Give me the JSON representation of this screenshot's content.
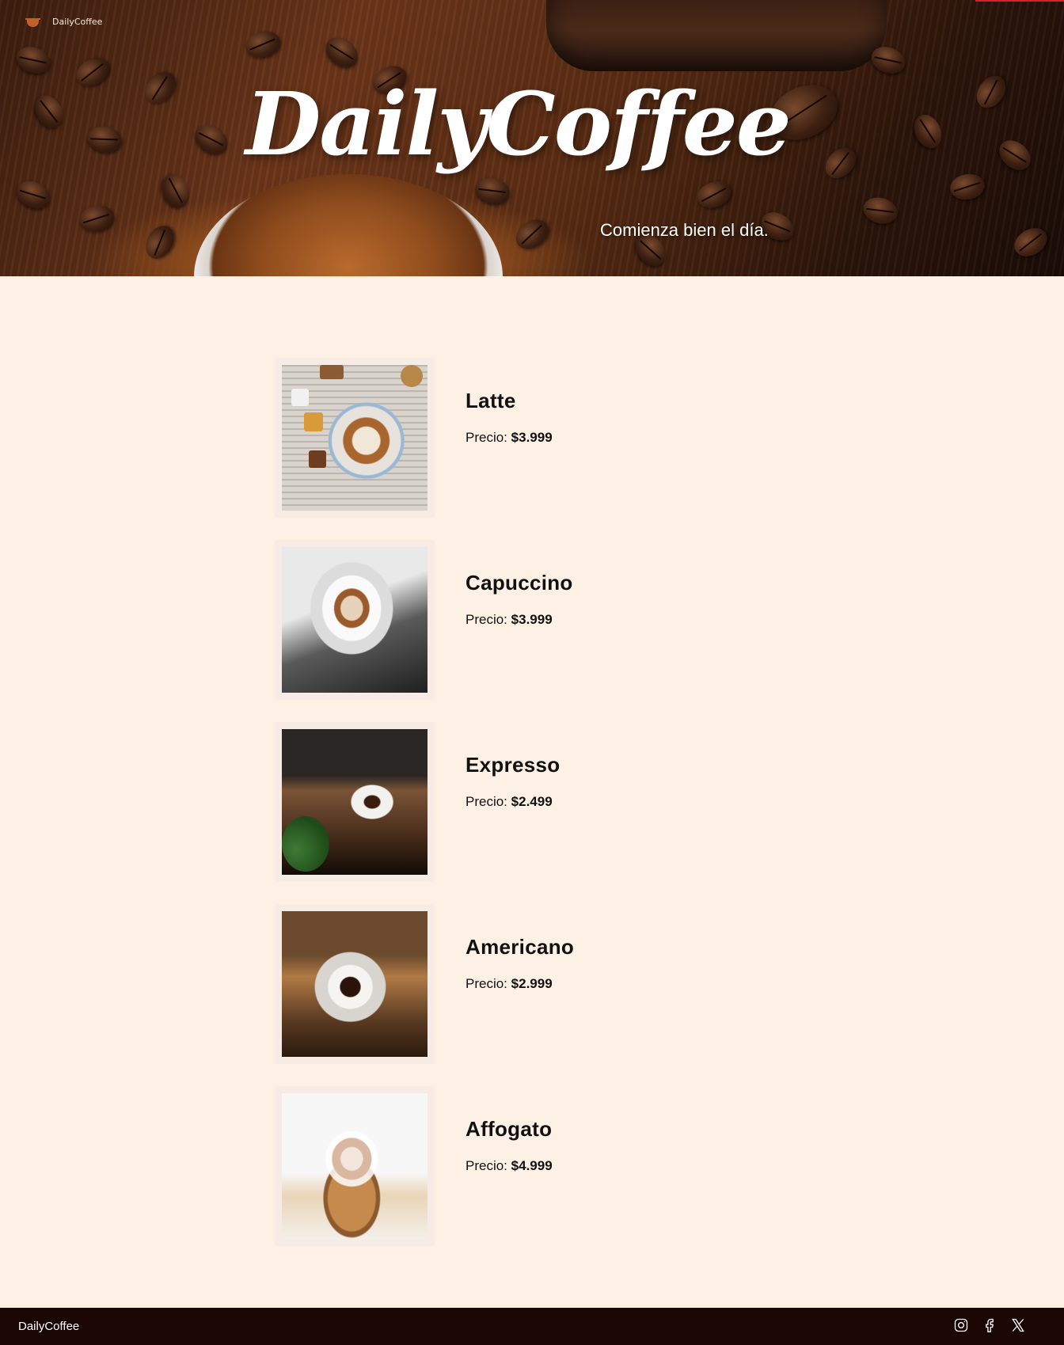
{
  "header": {
    "brand": "DailyCoffee",
    "title": "DailyCoffee",
    "subtitle": "Comienza bien el día."
  },
  "products": [
    {
      "name": "Latte",
      "price_label": "Precio:",
      "price": "$3.999"
    },
    {
      "name": "Capuccino",
      "price_label": "Precio:",
      "price": "$3.999"
    },
    {
      "name": "Expresso",
      "price_label": "Precio:",
      "price": "$2.499"
    },
    {
      "name": "Americano",
      "price_label": "Precio:",
      "price": "$2.999"
    },
    {
      "name": "Affogato",
      "price_label": "Precio:",
      "price": "$4.999"
    }
  ],
  "footer": {
    "brand": "DailyCoffee",
    "socials": [
      "instagram-icon",
      "facebook-icon",
      "x-icon"
    ]
  },
  "colors": {
    "background": "#fdf0e4",
    "footer": "#1b0606",
    "accent": "#d0262a",
    "logo": "#c0612a"
  }
}
